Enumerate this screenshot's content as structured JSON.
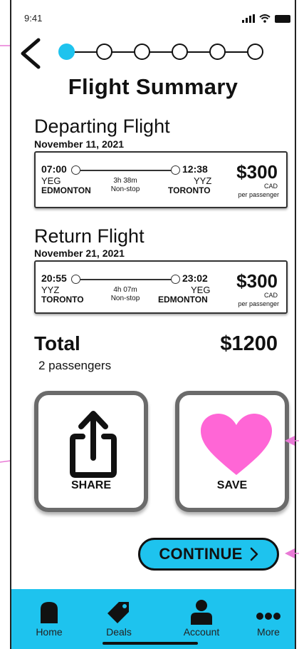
{
  "status": {
    "time": "9:41"
  },
  "progress": {
    "steps": 6,
    "active_step": 1
  },
  "page": {
    "title": "Flight Summary"
  },
  "departing": {
    "label": "Departing Flight",
    "date": "November 11, 2021",
    "dep_time": "07:00",
    "dep_code": "YEG",
    "dep_city": "EDMONTON",
    "duration": "3h 38m",
    "stops": "Non-stop",
    "arr_time": "12:38",
    "arr_code": "YYZ",
    "arr_city": "TORONTO",
    "price": "$300",
    "currency": "CAD",
    "per": "per passenger"
  },
  "return": {
    "label": "Return Flight",
    "date": "November 21, 2021",
    "dep_time": "20:55",
    "dep_code": "YYZ",
    "dep_city": "TORONTO",
    "duration": "4h 07m",
    "stops": "Non-stop",
    "arr_time": "23:02",
    "arr_code": "YEG",
    "arr_city": "EDMONTON",
    "price": "$300",
    "currency": "CAD",
    "per": "per passenger"
  },
  "total": {
    "label": "Total",
    "passengers": "2 passengers",
    "amount": "$1200"
  },
  "actions": {
    "share_label": "SHARE",
    "save_label": "SAVE"
  },
  "continue": {
    "label": "CONTINUE"
  },
  "nav": {
    "home": "Home",
    "deals": "Deals",
    "account": "Account",
    "more": "More"
  },
  "colors": {
    "accent": "#1ec3ee",
    "heart": "#ff66d6",
    "callout": "#e97ad6"
  }
}
